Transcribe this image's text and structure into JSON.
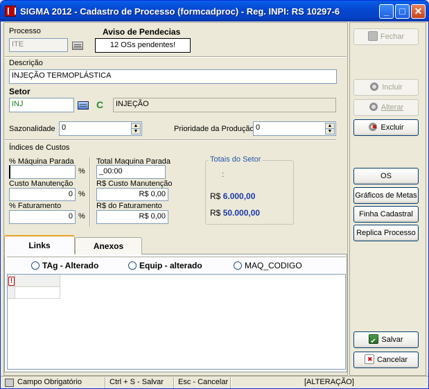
{
  "window": {
    "title": "SIGMA 2012 - Cadastro de Processo  (formcadproc)  - Reg. INPI: RS 10297-6",
    "min_glyph": "_",
    "max_glyph": "□",
    "close_glyph": "✕"
  },
  "form": {
    "processo_label": "Processo",
    "processo_value": "ITE",
    "aviso_title": "Aviso de Pendecias",
    "aviso_text": "12  OSs pendentes!",
    "descricao_label": "Descrição",
    "descricao_value": "INJEÇÃO TERMOPLÁSTICA",
    "setor_label": "Setor",
    "setor_code": "INJ",
    "setor_c": "C",
    "setor_name": "INJEÇÃO",
    "sazonalidade_label": "Sazonalidade",
    "sazonalidade_value": "0",
    "prioridade_label": "Prioridade da Produção",
    "prioridade_value": "0",
    "indices_label": "Índices de Custos",
    "maq_parada_label": "% Máquina Parada",
    "maq_parada_value": "",
    "percent": "%",
    "total_maq_parada_label": "Total Maquina Parada",
    "total_maq_parada_value": "_00:00",
    "custo_manut_label": "Custo Manutenção",
    "custo_manut_value": "0",
    "rs_custo_manut_label": "R$ Custo Manutenção",
    "rs_custo_manut_value": "R$ 0,00",
    "faturamento_label": "% Faturamento",
    "faturamento_value": "0",
    "rs_faturamento_label": "R$ do Faturamento",
    "rs_faturamento_value": "R$ 0,00",
    "totais_title": "Totais do Setor",
    "totais_colon": ":",
    "rs_prefix": "R$",
    "total1": "6.000,00",
    "total2": "50.000,00"
  },
  "tabs": {
    "links": "Links",
    "anexos": "Anexos"
  },
  "radios": {
    "tag": "TAg - Alterado",
    "equip": "Equip - alterado",
    "maq": "MAQ_CODIGO"
  },
  "grid": {
    "warn": "!"
  },
  "buttons": {
    "fechar": "Fechar",
    "incluir": "Incluir",
    "alterar": "Alterar",
    "excluir": "Excluir",
    "os": "OS",
    "graficos": "Gráficos de Metas",
    "finha": "Finha Cadastral",
    "replica": "Replica Processo",
    "salvar": "Salvar",
    "cancelar": "Cancelar"
  },
  "status": {
    "campo": "Campo Obrigatório",
    "ctrl": "Ctrl + S - Salvar",
    "esc": "Esc - Cancelar",
    "mode": "[ALTERAÇÃO]"
  },
  "icons": [
    "app-icon",
    "card-icon",
    "sector-card-icon",
    "spin-up-icon",
    "spin-down-icon",
    "door-icon",
    "gear-icon",
    "gear-delete-icon",
    "save-icon",
    "cancel-icon",
    "warning-icon"
  ]
}
